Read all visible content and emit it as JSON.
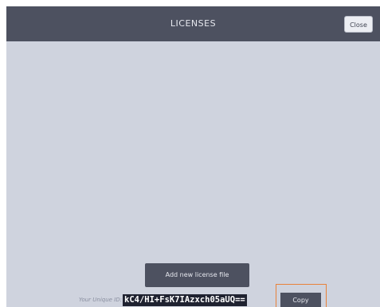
{
  "dialog": {
    "title": "LICENSES",
    "close_label": "Close"
  },
  "actions": {
    "add_license_label": "Add new license file",
    "copy_label": "Copy"
  },
  "unique_id": {
    "label": "Your Unique ID:",
    "value": "kC4/HI+FsK7IAzxch05aUQ=="
  },
  "colors": {
    "titlebar": "#4d5160",
    "content_background": "#cfd3de",
    "highlight": "#e8823a"
  }
}
